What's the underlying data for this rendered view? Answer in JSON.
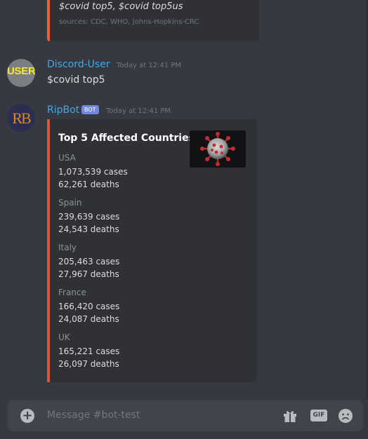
{
  "prev_embed": {
    "commands": "$covid top5, $covid top5us",
    "sources": "sources: CDC, WHO, Johns-Hopkins-CRC"
  },
  "messages": [
    {
      "author": "Discord-User",
      "avatar_text": "USER",
      "timestamp": "Today at 12:41 PM",
      "content": "$covid top5"
    },
    {
      "author": "RipBot",
      "avatar_text": "RB",
      "tag": "BOT",
      "timestamp": "Today at 12:41 PM"
    }
  ],
  "embed": {
    "title": "Top 5 Affected Countries",
    "accent_color": "#d8593a",
    "countries": [
      {
        "name": "USA",
        "cases": "1,073,539 cases",
        "deaths": "62,261 deaths"
      },
      {
        "name": "Spain",
        "cases": "239,639 cases",
        "deaths": "24,543 deaths"
      },
      {
        "name": "Italy",
        "cases": "205,463 cases",
        "deaths": "27,967 deaths"
      },
      {
        "name": "France",
        "cases": "166,420 cases",
        "deaths": "24,087 deaths"
      },
      {
        "name": "UK",
        "cases": "165,221 cases",
        "deaths": "26,097 deaths"
      }
    ]
  },
  "input": {
    "placeholder": "Message #bot-test",
    "gif_label": "GIF",
    "icons": [
      "plus-circle-icon",
      "gift-icon",
      "gif-icon",
      "emoji-icon"
    ]
  },
  "colors": {
    "background": "#36393f",
    "embed_background": "#2f3136",
    "username": "#43a8e8",
    "bot_tag": "#7289da"
  }
}
